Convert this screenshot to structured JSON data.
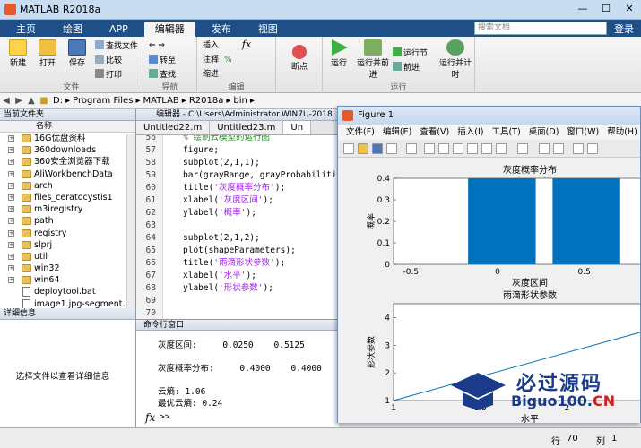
{
  "window": {
    "title": "MATLAB R2018a",
    "controls": [
      "—",
      "☐",
      "✕"
    ]
  },
  "tabs": [
    {
      "label": "主页",
      "active": false
    },
    {
      "label": "绘图",
      "active": false
    },
    {
      "label": "APP",
      "active": false
    },
    {
      "label": "编辑器",
      "active": true
    },
    {
      "label": "发布",
      "active": false
    },
    {
      "label": "视图",
      "active": false
    }
  ],
  "search": {
    "placeholder": "搜索文档",
    "login": "登录"
  },
  "ribbon": {
    "file": {
      "new": "新建",
      "open": "打开",
      "save": "保存",
      "find_files": "查找文件",
      "compare": "比较",
      "print": "打印",
      "group": "文件"
    },
    "nav": {
      "goto": "转至",
      "find": "查找",
      "group": "导航"
    },
    "edit": {
      "insert": "插入",
      "fx": "fx",
      "comment": "注释",
      "indent": "缩进",
      "group": "编辑"
    },
    "breakpoints": {
      "label": "断点"
    },
    "run": {
      "run": "运行",
      "run_advance": "运行并前进",
      "run_section": "运行节",
      "advance": "前进",
      "run_time": "运行并计时",
      "group": "运行"
    }
  },
  "address": {
    "crumbs": [
      "D:",
      "Program Files",
      "MATLAB",
      "R2018a",
      "bin"
    ]
  },
  "current_folder": {
    "header": "当前文件夹",
    "col": "名称",
    "items": [
      {
        "name": "16G优盘资料",
        "type": "folder"
      },
      {
        "name": "360downloads",
        "type": "folder"
      },
      {
        "name": "360安全浏览器下载",
        "type": "folder"
      },
      {
        "name": "AliWorkbenchData",
        "type": "folder"
      },
      {
        "name": "arch",
        "type": "folder"
      },
      {
        "name": "files_ceratocystis1",
        "type": "folder"
      },
      {
        "name": "m3iregistry",
        "type": "folder"
      },
      {
        "name": "path",
        "type": "folder"
      },
      {
        "name": "registry",
        "type": "folder"
      },
      {
        "name": "slprj",
        "type": "folder"
      },
      {
        "name": "util",
        "type": "folder"
      },
      {
        "name": "win32",
        "type": "folder"
      },
      {
        "name": "win64",
        "type": "folder"
      },
      {
        "name": "deploytool.bat",
        "type": "file"
      },
      {
        "name": "image1.jpg-segment…",
        "type": "file"
      }
    ]
  },
  "details": {
    "header": "详细信息",
    "text": "选择文件以查看详细信息"
  },
  "editor": {
    "header": "编辑器 - C:\\Users\\Administrator.WIN7U-2018",
    "tabs": [
      "Untitled22.m",
      "Untitled23.m",
      "Un"
    ],
    "lines": [
      {
        "n": "56",
        "code": "% 绘制云模型的运行图",
        "kind": "cmt"
      },
      {
        "n": "57",
        "code": "figure;",
        "kind": "plain"
      },
      {
        "n": "58",
        "code": "subplot(2,1,1);",
        "kind": "plain"
      },
      {
        "n": "59",
        "code": "bar(grayRange, grayProbabilities",
        "kind": "plain"
      },
      {
        "n": "60",
        "pre": "title(",
        "str": "'灰度概率分布'",
        "post": ");",
        "kind": "mixed"
      },
      {
        "n": "61",
        "pre": "xlabel(",
        "str": "'灰度区间'",
        "post": ");",
        "kind": "mixed"
      },
      {
        "n": "62",
        "pre": "ylabel(",
        "str": "'概率'",
        "post": ");",
        "kind": "mixed"
      },
      {
        "n": "63",
        "code": "",
        "kind": "plain"
      },
      {
        "n": "64",
        "code": "subplot(2,1,2);",
        "kind": "plain"
      },
      {
        "n": "65",
        "code": "plot(shapeParameters);",
        "kind": "plain"
      },
      {
        "n": "66",
        "pre": "title(",
        "str": "'雨滴形状参数'",
        "post": ");",
        "kind": "mixed"
      },
      {
        "n": "67",
        "pre": "xlabel(",
        "str": "'水平'",
        "post": ");",
        "kind": "mixed"
      },
      {
        "n": "68",
        "pre": "ylabel(",
        "str": "'形状参数'",
        "post": ");",
        "kind": "mixed"
      },
      {
        "n": "69",
        "code": "",
        "kind": "plain"
      },
      {
        "n": "70",
        "code": "",
        "kind": "plain"
      }
    ]
  },
  "command": {
    "header": "命令行窗口",
    "lines": [
      "灰度区间:     0.0250    0.5125",
      "",
      "灰度概率分布:     0.4000    0.4000",
      "",
      "云熵: 1.06",
      "最优云熵: 0.24"
    ],
    "prompt": "fx",
    "prompt_symbol": ">>"
  },
  "status": {
    "row_label": "行",
    "row": "70",
    "col_label": "列",
    "col": "1"
  },
  "figure": {
    "title": "Figure 1",
    "menu": [
      "文件(F)",
      "编辑(E)",
      "查看(V)",
      "插入(I)",
      "工具(T)",
      "桌面(D)",
      "窗口(W)",
      "帮助(H)"
    ]
  },
  "chart_data": [
    {
      "type": "bar",
      "title": "灰度概率分布",
      "xlabel": "灰度区间",
      "ylabel": "概率",
      "x": [
        0.025,
        0.5125
      ],
      "values": [
        0.4,
        0.4
      ],
      "xticks": [
        "-0.5",
        "0",
        "0.5"
      ],
      "yticks": [
        "0",
        "0.1",
        "0.2",
        "0.3",
        "0.4"
      ],
      "xlim": [
        -0.6,
        0.9
      ],
      "ylim": [
        0,
        0.4
      ],
      "color": "#0072bd"
    },
    {
      "type": "line",
      "title": "雨滴形状参数",
      "xlabel": "水平",
      "ylabel": "形状参数",
      "x": [
        1,
        2.5
      ],
      "y": [
        1.0,
        3.6
      ],
      "xticks": [
        "1",
        "1.5",
        "2"
      ],
      "yticks": [
        "1",
        "2",
        "3",
        "4"
      ],
      "xlim": [
        1,
        2.5
      ],
      "ylim": [
        1,
        4.5
      ],
      "color": "#0072bd"
    }
  ],
  "watermark": {
    "cn": "必过源码",
    "en_pre": "Biguo100.",
    "en_post": "CN"
  }
}
